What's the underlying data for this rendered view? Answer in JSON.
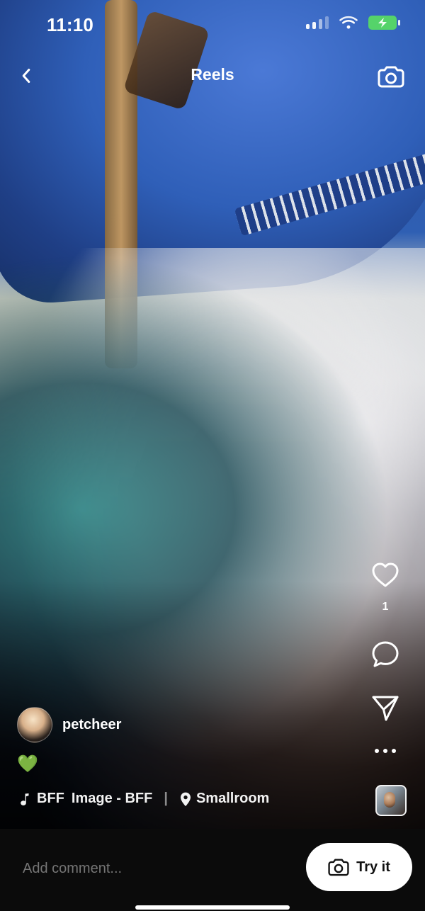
{
  "status_bar": {
    "time": "11:10",
    "battery_color": "#55d36a"
  },
  "top_nav": {
    "title": "Reels",
    "icons": {
      "back": "chevron-left-icon",
      "camera": "camera-icon"
    }
  },
  "actions": {
    "like_count": "1",
    "icons": {
      "like": "heart-icon",
      "comment": "comment-icon",
      "share": "send-icon",
      "more": "more-icon"
    }
  },
  "post": {
    "username": "petcheer",
    "caption": "💚",
    "music_tag": "BFF",
    "audio_title": "Image - BFF",
    "separator": "|",
    "location": "Smallroom",
    "icons": {
      "music": "music-note-icon",
      "location": "location-pin-icon"
    }
  },
  "comment_bar": {
    "placeholder": "Add comment...",
    "try_it_label": "Try it",
    "icons": {
      "try_it": "camera-icon"
    }
  }
}
